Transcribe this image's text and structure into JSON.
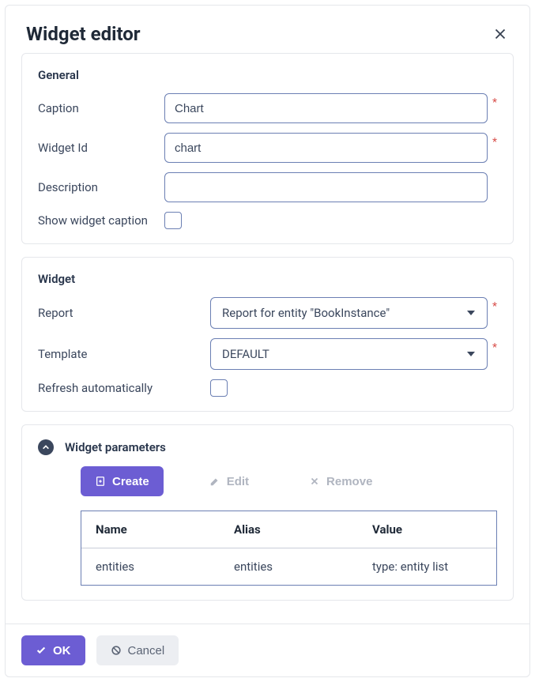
{
  "dialog": {
    "title": "Widget editor"
  },
  "general": {
    "legend": "General",
    "caption_label": "Caption",
    "caption_value": "Chart",
    "widget_id_label": "Widget Id",
    "widget_id_value": "chart",
    "description_label": "Description",
    "description_value": "",
    "show_caption_label": "Show widget caption"
  },
  "widget": {
    "legend": "Widget",
    "report_label": "Report",
    "report_value": "Report for entity \"BookInstance\"",
    "template_label": "Template",
    "template_value": "DEFAULT",
    "refresh_label": "Refresh automatically"
  },
  "params": {
    "legend": "Widget parameters",
    "create_label": "Create",
    "edit_label": "Edit",
    "remove_label": "Remove",
    "columns": {
      "name": "Name",
      "alias": "Alias",
      "value": "Value"
    },
    "rows": [
      {
        "name": "entities",
        "alias": "entities",
        "value": "type: entity list"
      }
    ]
  },
  "footer": {
    "ok_label": "OK",
    "cancel_label": "Cancel"
  }
}
